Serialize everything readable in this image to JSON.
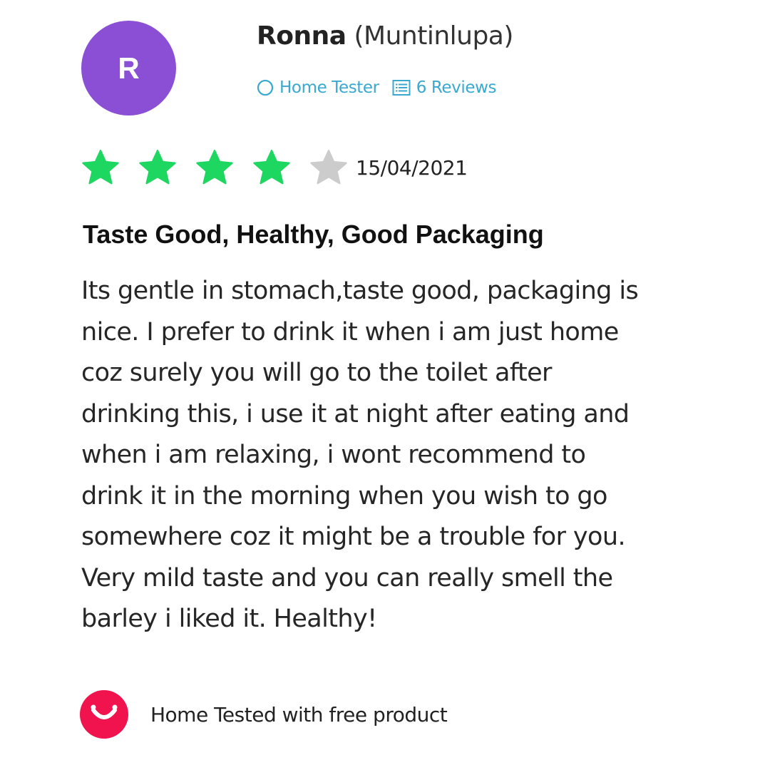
{
  "reviewer": {
    "initial": "R",
    "name": "Ronna",
    "location": "(Muntinlupa)",
    "avatar_color": "#8b4fd6"
  },
  "badges": [
    {
      "icon": "circle-icon",
      "label": "Home Tester"
    },
    {
      "icon": "list-icon",
      "label": "6 Reviews"
    }
  ],
  "rating": {
    "value": 4,
    "max": 5,
    "date": "15/04/2021",
    "filled_color": "#1ed760",
    "empty_color": "#cccccc"
  },
  "review": {
    "title": "Taste Good, Healthy, Good Packaging",
    "body_lines": [
      "Its gentle in stomach,taste good, packaging is",
      "nice. I prefer to drink it when i am just home",
      "coz surely you will go to the toilet after",
      "drinking this, i use it at night after eating and",
      "when i am relaxing, i wont recommend to",
      "drink it in the morning when you wish to go",
      "somewhere coz it might be a trouble for you.",
      "Very mild taste and you can really smell the",
      "barley i liked it. Healthy!"
    ]
  },
  "footer": {
    "icon": "smile-logo-icon",
    "text": "Home Tested with free product",
    "icon_color": "#f0134d"
  },
  "colors": {
    "link": "#3aa8cf",
    "text": "#222222"
  }
}
